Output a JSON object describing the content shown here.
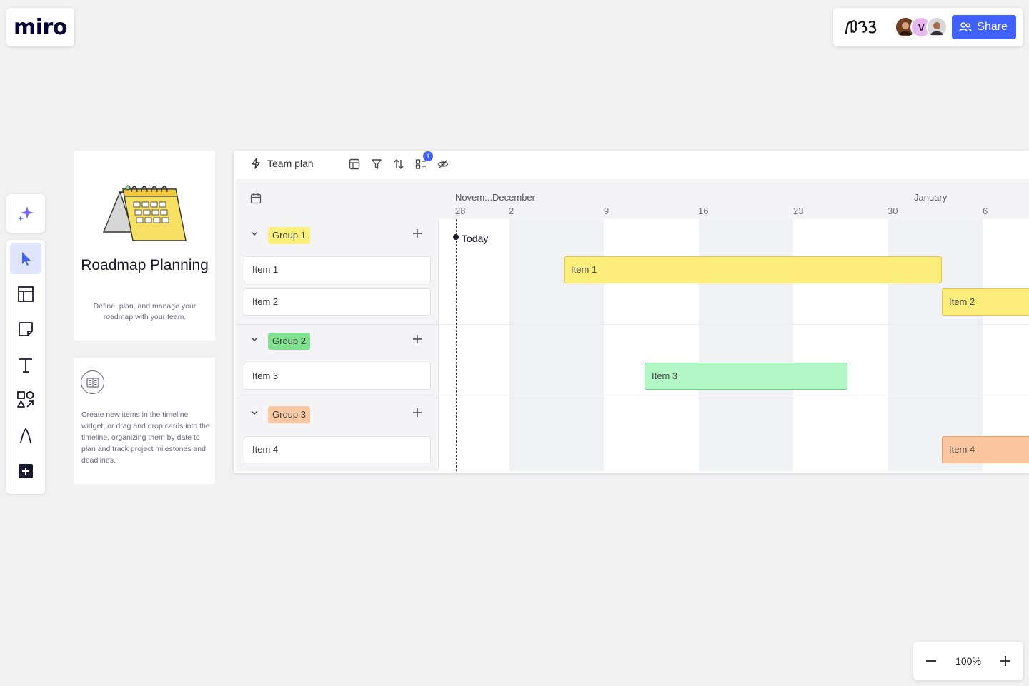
{
  "app": {
    "logo_text": "miro"
  },
  "topbar": {
    "avatars": [
      {
        "initial": "",
        "name": "user-avatar-1"
      },
      {
        "initial": "V",
        "name": "user-avatar-2"
      },
      {
        "initial": "",
        "name": "user-avatar-3"
      }
    ],
    "share_label": "Share"
  },
  "toolbar": {
    "ai_icon": "sparkle-icon",
    "tools": [
      "cursor-icon",
      "frame-icon",
      "sticky-note-icon",
      "text-icon",
      "shapes-icon",
      "pen-icon",
      "add-icon"
    ]
  },
  "card_intro": {
    "title": "Roadmap Planning",
    "description": "Define, plan, and manage your roadmap with your team."
  },
  "card_help": {
    "description": "Create new items in the timeline widget, or drag and drop cards into the timeline, organizing them by date to plan and track project milestones and deadlines."
  },
  "timeline": {
    "name": "Team plan",
    "filter_badge": "1",
    "months": {
      "first": "Novem...December",
      "second": "January"
    },
    "days": [
      "28",
      "2",
      "9",
      "16",
      "23",
      "30",
      "6"
    ],
    "today_label": "Today",
    "groups": [
      {
        "label": "Group 1",
        "color": "#fdf07a",
        "items": [
          "Item 1",
          "Item 2"
        ]
      },
      {
        "label": "Group 2",
        "color": "#7fe08f",
        "items": [
          "Item 3"
        ]
      },
      {
        "label": "Group 3",
        "color": "#fcc9a2",
        "items": [
          "Item 4"
        ]
      }
    ],
    "bars": [
      {
        "label": "Item 1",
        "color": "#fdee7b",
        "border": "#e3c64a"
      },
      {
        "label": "Item 2",
        "color": "#fdee7b",
        "border": "#e3c64a"
      },
      {
        "label": "Item 3",
        "color": "#b3f7c6",
        "border": "#6dcf86"
      },
      {
        "label": "Item 4",
        "color": "#fcc6a0",
        "border": "#e9a06a"
      }
    ]
  },
  "zoom": {
    "level": "100%"
  }
}
